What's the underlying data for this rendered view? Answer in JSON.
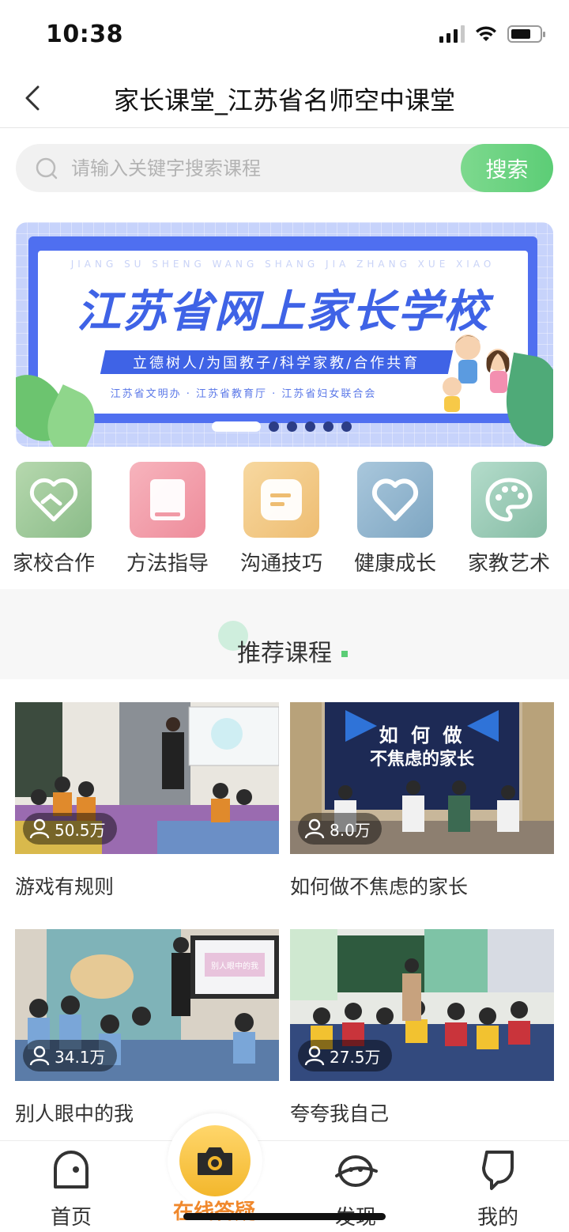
{
  "status_bar": {
    "time": "10:38"
  },
  "nav": {
    "title": "家长课堂_江苏省名师空中课堂"
  },
  "search": {
    "placeholder": "请输入关键字搜索课程",
    "button_label": "搜索"
  },
  "banner": {
    "pinyin": "JIANG SU SHENG WANG SHANG JIA ZHANG XUE XIAO",
    "title": "江苏省网上家长学校",
    "slogan": "立德树人/为国教子/科学家教/合作共育",
    "orgs": "江苏省文明办 · 江苏省教育厅 · 江苏省妇女联合会",
    "slide_count": 6,
    "active_slide": 1
  },
  "categories": [
    {
      "label": "家校合作",
      "icon": "handshake-heart-icon",
      "color": "#9fc79c"
    },
    {
      "label": "方法指导",
      "icon": "book-icon",
      "color": "#f19aa6"
    },
    {
      "label": "沟通技巧",
      "icon": "message-icon",
      "color": "#f2c889"
    },
    {
      "label": "健康成长",
      "icon": "heart-icon",
      "color": "#93b6cf"
    },
    {
      "label": "家教艺术",
      "icon": "palette-icon",
      "color": "#9ccbb8"
    }
  ],
  "recommend": {
    "title": "推荐课程"
  },
  "courses": [
    {
      "title": "游戏有规则",
      "views": "50.5万"
    },
    {
      "title": "如何做不焦虑的家长",
      "views": "8.0万",
      "thumb_text_1": "如 何 做",
      "thumb_text_2": "不焦虑的家长"
    },
    {
      "title": "别人眼中的我",
      "views": "34.1万",
      "thumb_text": "别人眼中的我"
    },
    {
      "title": "夸夸我自己",
      "views": "27.5万"
    }
  ],
  "tabs": [
    {
      "label": "首页",
      "icon": "home-icon"
    },
    {
      "label": "在线答疑",
      "icon": "camera-icon"
    },
    {
      "label": "发现",
      "icon": "discover-icon"
    },
    {
      "label": "我的",
      "icon": "profile-icon"
    }
  ],
  "colors": {
    "accent_green": "#5ccd76",
    "accent_orange": "#f0882c",
    "banner_blue": "#3f63e6"
  }
}
